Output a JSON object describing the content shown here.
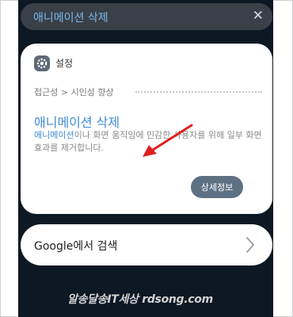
{
  "search": {
    "text": "애니메이션 삭제",
    "close_icon": "close-icon"
  },
  "result_card": {
    "app_icon": "gear-icon",
    "app_name": "설정",
    "breadcrumb": "접근성 > 시인성 향상",
    "title": "애니메이션 삭제",
    "description_highlight": "애니메이션",
    "description_rest": "이나 화면 움직임에 민감한 사용자를 위해 일부 화면 효과를 제거합니다.",
    "detail_button": "상세정보",
    "arrow_color": "#e02020"
  },
  "google_search": {
    "label": "Google에서 검색",
    "chevron_icon": "chevron-right-icon"
  },
  "watermark": "알송달송IT세상 rdsong.com",
  "colors": {
    "accent": "#3f8bd6",
    "background": "#0c1824",
    "button": "#5e7184"
  }
}
